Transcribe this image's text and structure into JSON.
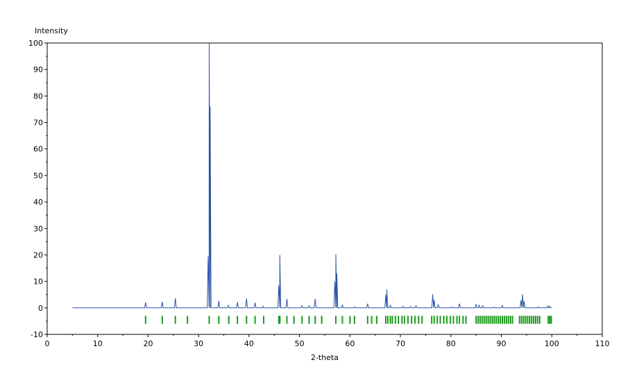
{
  "chart_data": {
    "type": "line",
    "title": "",
    "xlabel": "2-theta",
    "ylabel": "Intensity",
    "xlim": [
      0,
      110
    ],
    "ylim": [
      -10,
      100
    ],
    "x_ticks": [
      0,
      10,
      20,
      30,
      40,
      50,
      60,
      70,
      80,
      90,
      100,
      110
    ],
    "y_ticks": [
      -10,
      0,
      10,
      20,
      30,
      40,
      50,
      60,
      70,
      80,
      90,
      100
    ],
    "x_tick_labels": [
      "0",
      "10",
      "20",
      "30",
      "40",
      "50",
      "60",
      "70",
      "80",
      "90",
      "100",
      "110"
    ],
    "y_tick_labels": [
      "-10",
      "0",
      "10",
      "20",
      "30",
      "40",
      "50",
      "60",
      "70",
      "80",
      "90",
      "100"
    ],
    "grid": false,
    "legend": "none",
    "colors": {
      "pattern": "#2a52a8",
      "reflections": "#1a9a1a",
      "axis": "#000000"
    },
    "pattern": {
      "x_start": 5,
      "x_end": 100,
      "baseline": 0,
      "peaks": [
        {
          "x": 19.5,
          "y": 2.1
        },
        {
          "x": 22.8,
          "y": 2.3
        },
        {
          "x": 25.4,
          "y": 3.6
        },
        {
          "x": 31.9,
          "y": 19.5
        },
        {
          "x": 32.1,
          "y": 100
        },
        {
          "x": 32.3,
          "y": 76
        },
        {
          "x": 34.0,
          "y": 2.6
        },
        {
          "x": 35.9,
          "y": 1.0
        },
        {
          "x": 37.7,
          "y": 2.2
        },
        {
          "x": 39.5,
          "y": 3.6
        },
        {
          "x": 41.2,
          "y": 2.0
        },
        {
          "x": 42.8,
          "y": 0.6
        },
        {
          "x": 45.9,
          "y": 8.5
        },
        {
          "x": 46.1,
          "y": 20
        },
        {
          "x": 47.5,
          "y": 3.4
        },
        {
          "x": 50.5,
          "y": 0.8
        },
        {
          "x": 51.9,
          "y": 0.7
        },
        {
          "x": 53.1,
          "y": 3.4
        },
        {
          "x": 57.0,
          "y": 10
        },
        {
          "x": 57.2,
          "y": 20.3
        },
        {
          "x": 57.4,
          "y": 13
        },
        {
          "x": 58.5,
          "y": 1.0
        },
        {
          "x": 60.9,
          "y": 0.4
        },
        {
          "x": 63.5,
          "y": 1.6
        },
        {
          "x": 67.1,
          "y": 5.0
        },
        {
          "x": 67.3,
          "y": 7.0
        },
        {
          "x": 68.0,
          "y": 1.0
        },
        {
          "x": 70.5,
          "y": 0.6
        },
        {
          "x": 72.0,
          "y": 0.5
        },
        {
          "x": 73.1,
          "y": 0.8
        },
        {
          "x": 76.4,
          "y": 5.1
        },
        {
          "x": 76.7,
          "y": 3.0
        },
        {
          "x": 77.5,
          "y": 1.2
        },
        {
          "x": 80.3,
          "y": 0.4
        },
        {
          "x": 81.7,
          "y": 1.6
        },
        {
          "x": 85.0,
          "y": 1.3
        },
        {
          "x": 85.6,
          "y": 1.0
        },
        {
          "x": 86.3,
          "y": 0.8
        },
        {
          "x": 88.5,
          "y": 0.3
        },
        {
          "x": 90.2,
          "y": 0.9
        },
        {
          "x": 93.9,
          "y": 3.0
        },
        {
          "x": 94.2,
          "y": 5.2
        },
        {
          "x": 94.5,
          "y": 2.6
        },
        {
          "x": 97.3,
          "y": 0.4
        },
        {
          "x": 99.2,
          "y": 0.8
        },
        {
          "x": 99.6,
          "y": 0.6
        }
      ]
    },
    "reflections": {
      "y_range": [
        -6,
        -3
      ],
      "x": [
        19.5,
        22.8,
        25.4,
        27.8,
        32.1,
        34.0,
        36.0,
        37.7,
        39.5,
        41.2,
        42.9,
        45.9,
        46.1,
        47.5,
        48.9,
        50.5,
        51.9,
        53.1,
        54.4,
        57.2,
        58.5,
        60.0,
        60.9,
        63.5,
        64.3,
        65.3,
        67.1,
        67.5,
        68.0,
        68.4,
        69.0,
        69.6,
        70.3,
        70.8,
        71.5,
        72.2,
        72.9,
        73.6,
        74.3,
        76.2,
        76.7,
        77.3,
        77.9,
        78.6,
        79.2,
        79.9,
        80.5,
        81.2,
        81.7,
        82.4,
        83.0,
        85.0,
        85.4,
        85.8,
        86.2,
        86.6,
        87.0,
        87.4,
        87.8,
        88.2,
        88.6,
        89.0,
        89.4,
        89.8,
        90.2,
        90.6,
        91.0,
        91.4,
        91.8,
        92.2,
        93.6,
        94.0,
        94.4,
        94.8,
        95.2,
        95.6,
        96.0,
        96.4,
        96.8,
        97.2,
        97.6,
        99.3,
        99.6,
        99.9
      ]
    }
  }
}
